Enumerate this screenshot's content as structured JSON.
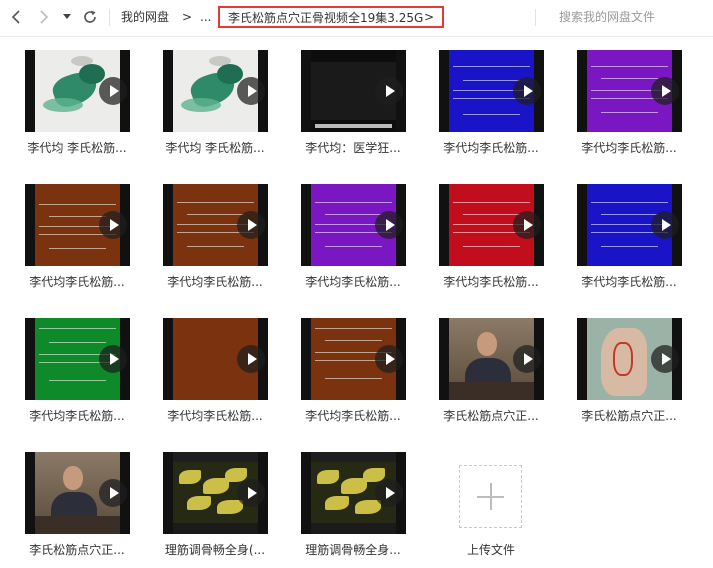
{
  "breadcrumb": {
    "root": "我的网盘",
    "sep1": ">",
    "ellipsis": "...",
    "current": "李氏松筋点穴正骨视频全19集3.25G",
    "current_arrow": ">"
  },
  "search": {
    "placeholder": "搜索我的网盘文件"
  },
  "colors": {
    "highlight_border": "#e53935"
  },
  "files": [
    {
      "name": "李代均 李氏松筋...",
      "thumb": "ink-painting"
    },
    {
      "name": "李代均 李氏松筋...",
      "thumb": "ink-painting"
    },
    {
      "name": "李代均：医学狂...",
      "thumb": "dark-video"
    },
    {
      "name": "李代均李氏松筋...",
      "thumb": "blue-title"
    },
    {
      "name": "李代均李氏松筋...",
      "thumb": "purple-title"
    },
    {
      "name": "李代均李氏松筋...",
      "thumb": "brown-title"
    },
    {
      "name": "李代均李氏松筋...",
      "thumb": "brown-title"
    },
    {
      "name": "李代均李氏松筋...",
      "thumb": "purple-title"
    },
    {
      "name": "李代均李氏松筋...",
      "thumb": "red-title"
    },
    {
      "name": "李代均李氏松筋...",
      "thumb": "blue-title"
    },
    {
      "name": "李代均李氏松筋...",
      "thumb": "green-title"
    },
    {
      "name": "李代均李氏松筋...",
      "thumb": "brown-plain"
    },
    {
      "name": "李代均李氏松筋...",
      "thumb": "brown-title"
    },
    {
      "name": "李氏松筋点穴正...",
      "thumb": "lecturer"
    },
    {
      "name": "李氏松筋点穴正...",
      "thumb": "arm-closeup"
    },
    {
      "name": "李氏松筋点穴正...",
      "thumb": "lecturer"
    },
    {
      "name": "理筋调骨畅全身(...",
      "thumb": "plant"
    },
    {
      "name": "理筋调骨畅全身...",
      "thumb": "plant"
    }
  ],
  "upload": {
    "label": "上传文件"
  }
}
